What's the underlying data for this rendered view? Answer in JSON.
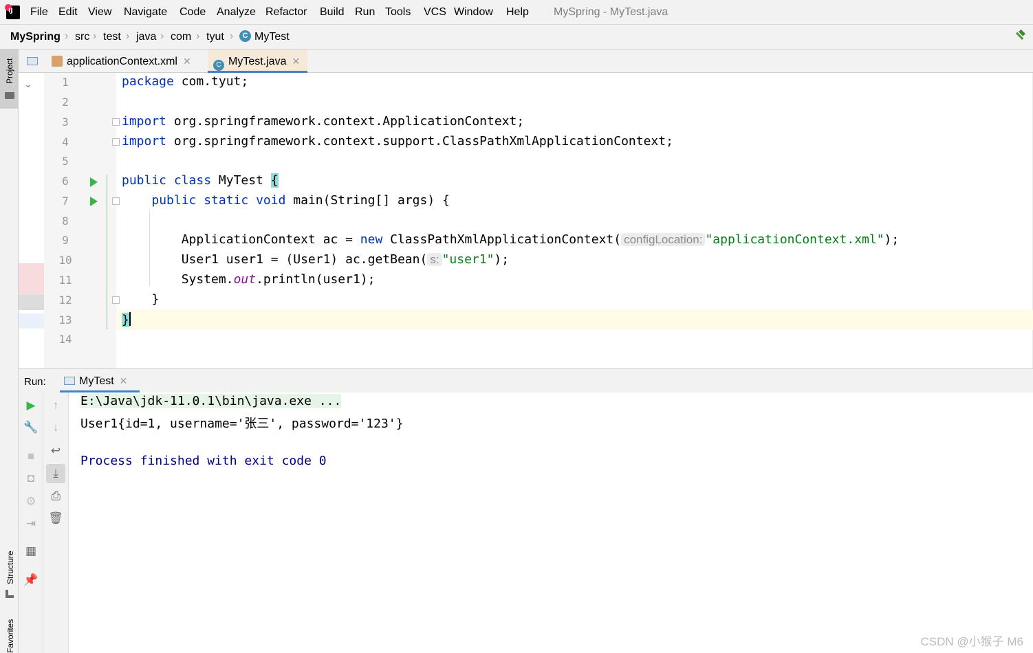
{
  "menu": [
    "File",
    "Edit",
    "View",
    "Navigate",
    "Code",
    "Analyze",
    "Refactor",
    "Build",
    "Run",
    "Tools",
    "VCS",
    "Window",
    "Help"
  ],
  "window_title": "MySpring - MyTest.java",
  "breadcrumb": [
    "MySpring",
    "src",
    "test",
    "java",
    "com",
    "tyut",
    "MyTest"
  ],
  "side_tabs": {
    "project": "Project",
    "structure": "Structure",
    "favorites": "Favorites"
  },
  "tabs": [
    {
      "label": "applicationContext.xml",
      "active": false
    },
    {
      "label": "MyTest.java",
      "active": true
    }
  ],
  "line_numbers": [
    "1",
    "2",
    "3",
    "4",
    "5",
    "6",
    "7",
    "8",
    "9",
    "10",
    "11",
    "12",
    "13",
    "14"
  ],
  "code": {
    "l1": {
      "kw": "package",
      "rest": " com.tyut;"
    },
    "l3": {
      "kw": "import",
      "rest": " org.springframework.context.ApplicationContext;"
    },
    "l4": {
      "kw": "import",
      "rest": " org.springframework.context.support.ClassPathXmlApplicationContext;"
    },
    "l6": {
      "kw": "public class",
      "name": " MyTest ",
      "brace": "{"
    },
    "l7": {
      "indent": "    ",
      "kw": "public static void",
      "rest": " main(String[] args) {"
    },
    "l9": {
      "pre": "        ApplicationContext ac = ",
      "kw": "new",
      "mid": " ClassPathXmlApplicationContext(",
      "hint": "configLocation:",
      "str": "\"applicationContext.xml\"",
      "post": ");"
    },
    "l10": {
      "pre": "        User1 user1 = (User1) ac.getBean(",
      "hint": "s:",
      "str": "\"user1\"",
      "post": ");"
    },
    "l11": {
      "pre": "        System.",
      "field": "out",
      "post": ".println(user1);"
    },
    "l12": {
      "text": "    }"
    },
    "l13": {
      "text": "}"
    }
  },
  "run": {
    "label": "Run:",
    "tab": "MyTest",
    "console": [
      "E:\\Java\\jdk-11.0.1\\bin\\java.exe ...",
      "User1{id=1, username='张三', password='123'}",
      "",
      "Process finished with exit code 0"
    ]
  },
  "watermark": "CSDN @小猴子 M6",
  "colors": {
    "keyword": "#0033b3",
    "string": "#067d17",
    "field": "#871094",
    "run_green": "#3bb44a",
    "accent": "#4083c9"
  }
}
